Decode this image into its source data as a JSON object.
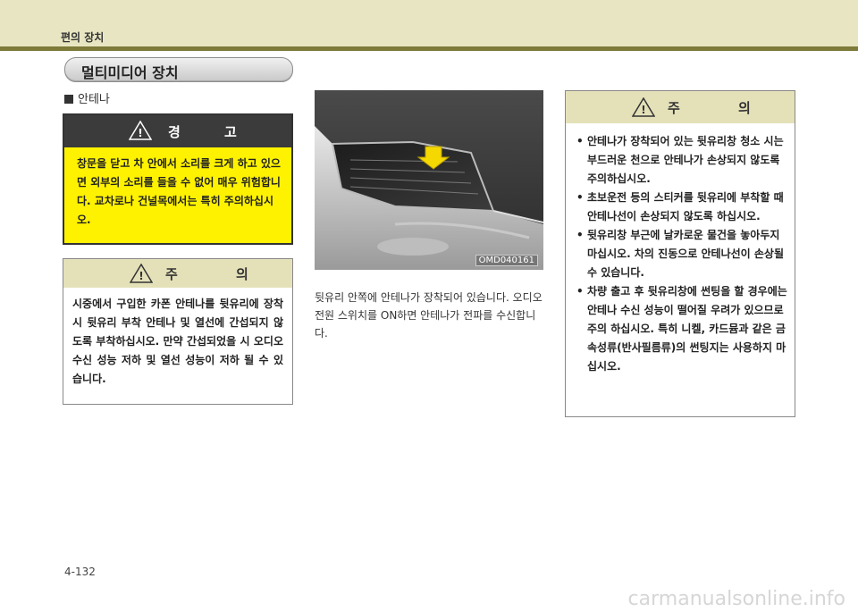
{
  "header": {
    "title": "편의 장치"
  },
  "section": {
    "title": "멀티미디어 장치"
  },
  "subheading": "안테나",
  "warning": {
    "title": "경 고",
    "body": "창문을 닫고 차 안에서 소리를 크게 하고 있으면 외부의 소리를 들을 수 없어 매우 위험합니다. 교차로나 건널목에서는 특히 주의하십시오."
  },
  "caution_left": {
    "title": "주 의",
    "body": "시중에서 구입한 카폰 안테나를 뒷유리에 장착시 뒷유리 부착 안테나 및 열선에 간섭되지 않도록 부착하십시오. 만약 간섭되었을 시 오디오 수신 성능 저하 및 열선 성능이 저하 될 수 있습니다."
  },
  "image": {
    "code": "OMD040161"
  },
  "description": "뒷유리 안쪽에 안테나가 장착되어 있습니다. 오디오 전원 스위치를 ON하면 안테나가 전파를 수신합니다.",
  "caution_right": {
    "title": "주 의",
    "items": [
      "안테나가 장착되어 있는 뒷유리창 청소 시는 부드러운 천으로 안테나가 손상되지 않도록 주의하십시오.",
      "초보운전 등의 스티커를 뒷유리에 부착할 때 안테나선이 손상되지 않도록 하십시오.",
      "뒷유리창 부근에 날카로운 물건을 놓아두지 마십시오. 차의 진동으로 안테나선이 손상될 수 있습니다.",
      "차량 출고 후 뒷유리창에 썬팅을 할 경우에는 안테나 수신 성능이 떨어질 우려가 있으므로 주의 하십시오. 특히 니켈, 카드뮴과 같은 금속성류(반사필름류)의 썬팅지는 사용하지 마십시오."
    ]
  },
  "page_number": "4-132",
  "watermark": "carmanualsonline.info",
  "colors": {
    "header_bg": "#e8e6c2",
    "header_line": "#7d7a3a",
    "warning_bg": "#fff200",
    "caution_head": "#e4e1b9"
  }
}
